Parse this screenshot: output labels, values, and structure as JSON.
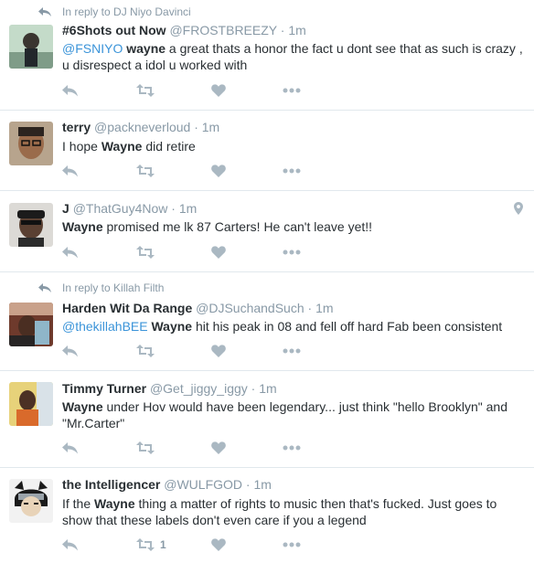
{
  "colors": {
    "meta": "#8899a6",
    "link": "#3b94d9",
    "text": "#292f33",
    "icon": "#aab8c2",
    "border": "#e1e8ed"
  },
  "tweets": [
    {
      "reply_context": "In reply to DJ Niyo Davinci",
      "name": "#6Shots out Now",
      "handle": "@FROSTBREEZY",
      "dot": "·",
      "time": "1m",
      "parts": [
        {
          "t": "@FSNIYO",
          "k": "mention"
        },
        {
          "t": " ",
          "k": "plain"
        },
        {
          "t": "wayne",
          "k": "hl"
        },
        {
          "t": " a great thats a honor the fact u dont see that as such is crazy , u disrespect a idol u worked with",
          "k": "plain"
        }
      ],
      "retweet_count": ""
    },
    {
      "name": "terry",
      "handle": "@packneverloud",
      "dot": "·",
      "time": "1m",
      "parts": [
        {
          "t": "I hope ",
          "k": "plain"
        },
        {
          "t": "Wayne",
          "k": "hl"
        },
        {
          "t": " did retire",
          "k": "plain"
        }
      ],
      "retweet_count": ""
    },
    {
      "name": "J",
      "handle": "@ThatGuy4Now",
      "dot": "·",
      "time": "1m",
      "has_location": true,
      "parts": [
        {
          "t": "Wayne",
          "k": "hl"
        },
        {
          "t": " promised me lk 87 Carters! He can't leave yet!!",
          "k": "plain"
        }
      ],
      "retweet_count": ""
    },
    {
      "reply_context": "In reply to Killah Filth",
      "name": "Harden Wit Da Range",
      "handle": "@DJSuchandSuch",
      "dot": "·",
      "time": "1m",
      "parts": [
        {
          "t": "@thekillahBEE",
          "k": "mention"
        },
        {
          "t": " ",
          "k": "plain"
        },
        {
          "t": "Wayne",
          "k": "hl"
        },
        {
          "t": " hit his peak in 08 and fell off hard  Fab been consistent",
          "k": "plain"
        }
      ],
      "retweet_count": ""
    },
    {
      "name": "Timmy Turner",
      "handle": "@Get_jiggy_iggy",
      "dot": "·",
      "time": "1m",
      "parts": [
        {
          "t": "Wayne",
          "k": "hl"
        },
        {
          "t": " under Hov would have been legendary... just think \"hello Brooklyn\" and \"Mr.Carter\"",
          "k": "plain"
        }
      ],
      "retweet_count": ""
    },
    {
      "name": "the Intelligencer",
      "handle": "@WULFGOD",
      "dot": "·",
      "time": "1m",
      "parts": [
        {
          "t": "If the ",
          "k": "plain"
        },
        {
          "t": "Wayne",
          "k": "hl"
        },
        {
          "t": " thing a matter of rights to music then that's fucked. Just goes to show that these labels don't even care if you a legend",
          "k": "plain"
        }
      ],
      "retweet_count": "1"
    }
  ]
}
